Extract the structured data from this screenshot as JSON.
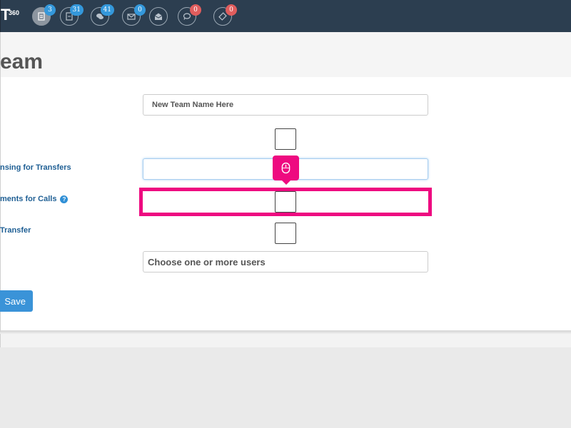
{
  "header": {
    "logo": "T",
    "logo_sup": "360",
    "icons": [
      {
        "name": "document-icon",
        "badge": "3",
        "badge_color": "#3498db",
        "active": true
      },
      {
        "name": "file-icon",
        "badge": "31",
        "badge_color": "#3498db",
        "active": false
      },
      {
        "name": "chat-icon",
        "badge": "41",
        "badge_color": "#3498db",
        "active": false
      },
      {
        "name": "mail-icon",
        "badge": "0",
        "badge_color": "#3498db",
        "active": false
      },
      {
        "name": "open-mail-icon",
        "badge": "",
        "badge_color": "",
        "active": false
      },
      {
        "name": "comment-icon",
        "badge": "0",
        "badge_color": "#e05d5d",
        "active": false
      },
      {
        "name": "ticket-icon",
        "badge": "0",
        "badge_color": "#e05d5d",
        "active": false
      }
    ]
  },
  "page": {
    "title": "eam"
  },
  "form": {
    "team_name_placeholder": "New Team Name Here",
    "label_transfers": "nsing for Transfers",
    "label_calls": "ments for Calls",
    "help_icon": "?",
    "label_transfer": "Transfer",
    "users_placeholder": "Choose one or more users",
    "save_label": "Save"
  },
  "colors": {
    "accent": "#3a93d8",
    "highlight": "#ee0a80",
    "label": "#1f5f94",
    "topbar": "#2c3e50"
  }
}
